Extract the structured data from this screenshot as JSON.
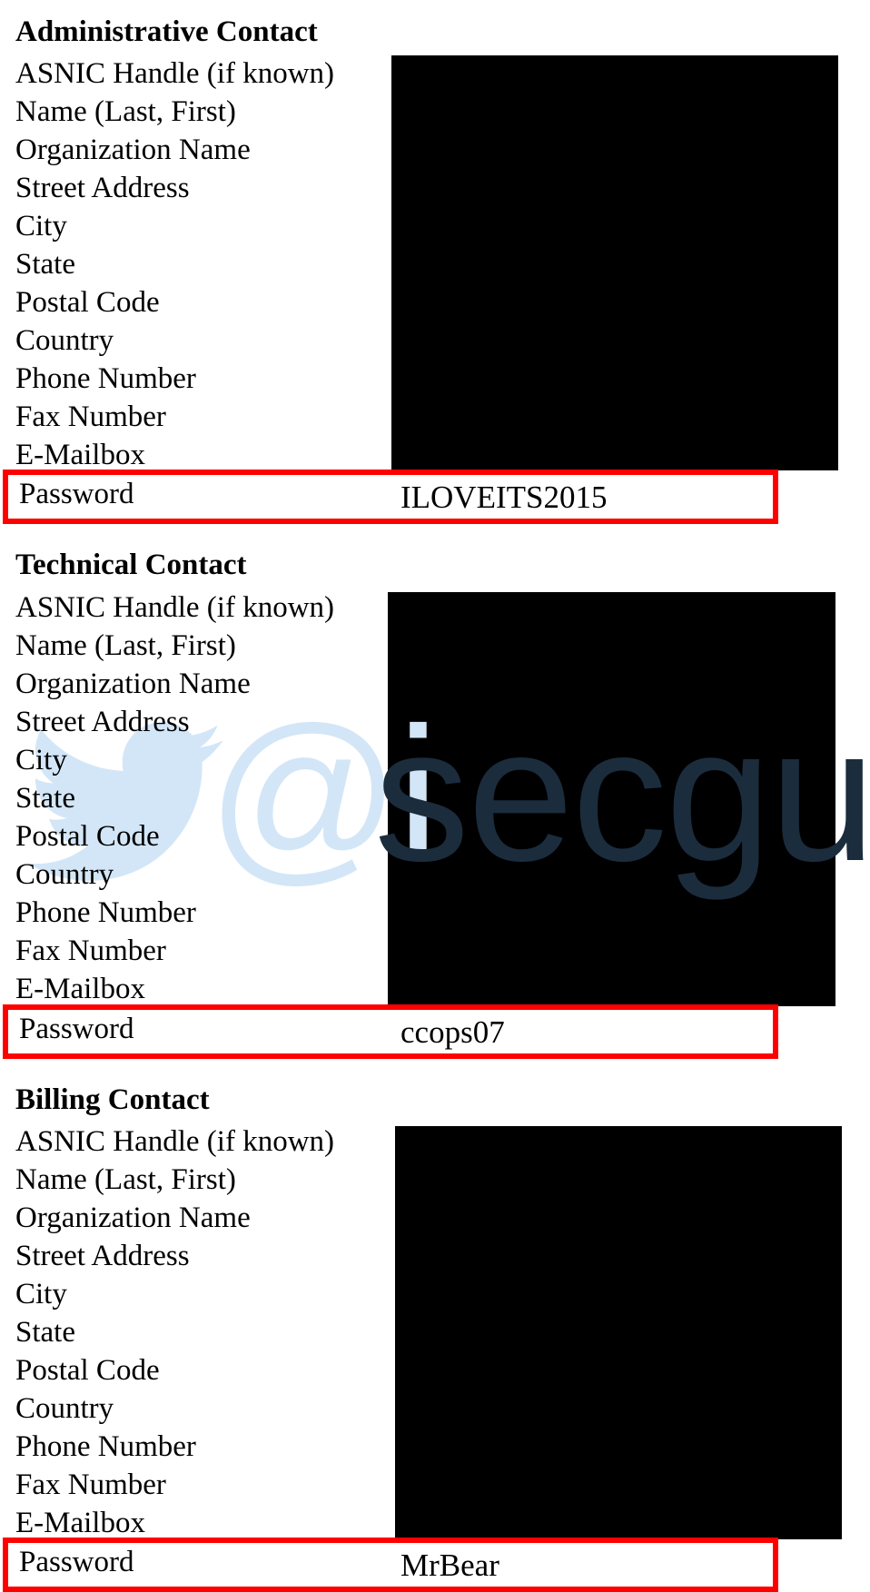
{
  "field_labels": [
    "ASNIC Handle (if known)",
    "Name (Last, First)",
    "Organization Name",
    "Street Address",
    "City",
    "State",
    "Postal Code",
    "Country",
    "Phone Number",
    "Fax Number",
    "E-Mailbox"
  ],
  "sections": [
    {
      "title": "Administrative Contact",
      "password_label": "Password",
      "password_value": "ILOVEITS2015"
    },
    {
      "title": "Technical Contact",
      "password_label": "Password",
      "password_value": "ccops07"
    },
    {
      "title": "Billing Contact",
      "password_label": "Password",
      "password_value": "MrBear"
    }
  ],
  "watermark": {
    "at_sign": "@i",
    "handle": "secguy",
    "bird_color": "#d3e6f7",
    "handle_color": "#1b2c3d"
  },
  "colors": {
    "highlight_border": "#ff0000",
    "redaction": "#000000"
  }
}
